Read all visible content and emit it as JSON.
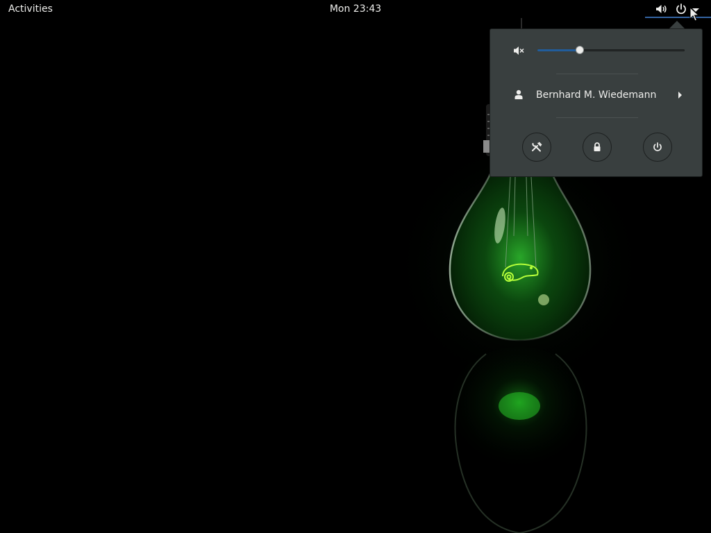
{
  "top_bar": {
    "activities_label": "Activities",
    "clock": "Mon 23:43"
  },
  "system_menu": {
    "volume": {
      "icon": "speaker-muted-icon",
      "level": 0.29
    },
    "user": {
      "name": "Bernhard M. Wiedemann",
      "icon": "person-icon"
    },
    "buttons": [
      {
        "icon": "settings-tools-icon"
      },
      {
        "icon": "lock-icon"
      },
      {
        "icon": "power-icon"
      }
    ]
  },
  "indicator_icons": [
    "volume-icon",
    "power-icon",
    "dropdown-arrow-icon"
  ],
  "colors": {
    "panel_bg": "#000000",
    "menu_bg": "#393f3f",
    "accent": "#215d9c",
    "text": "#eeeeec",
    "bulb_glow": "#3fd63f"
  }
}
